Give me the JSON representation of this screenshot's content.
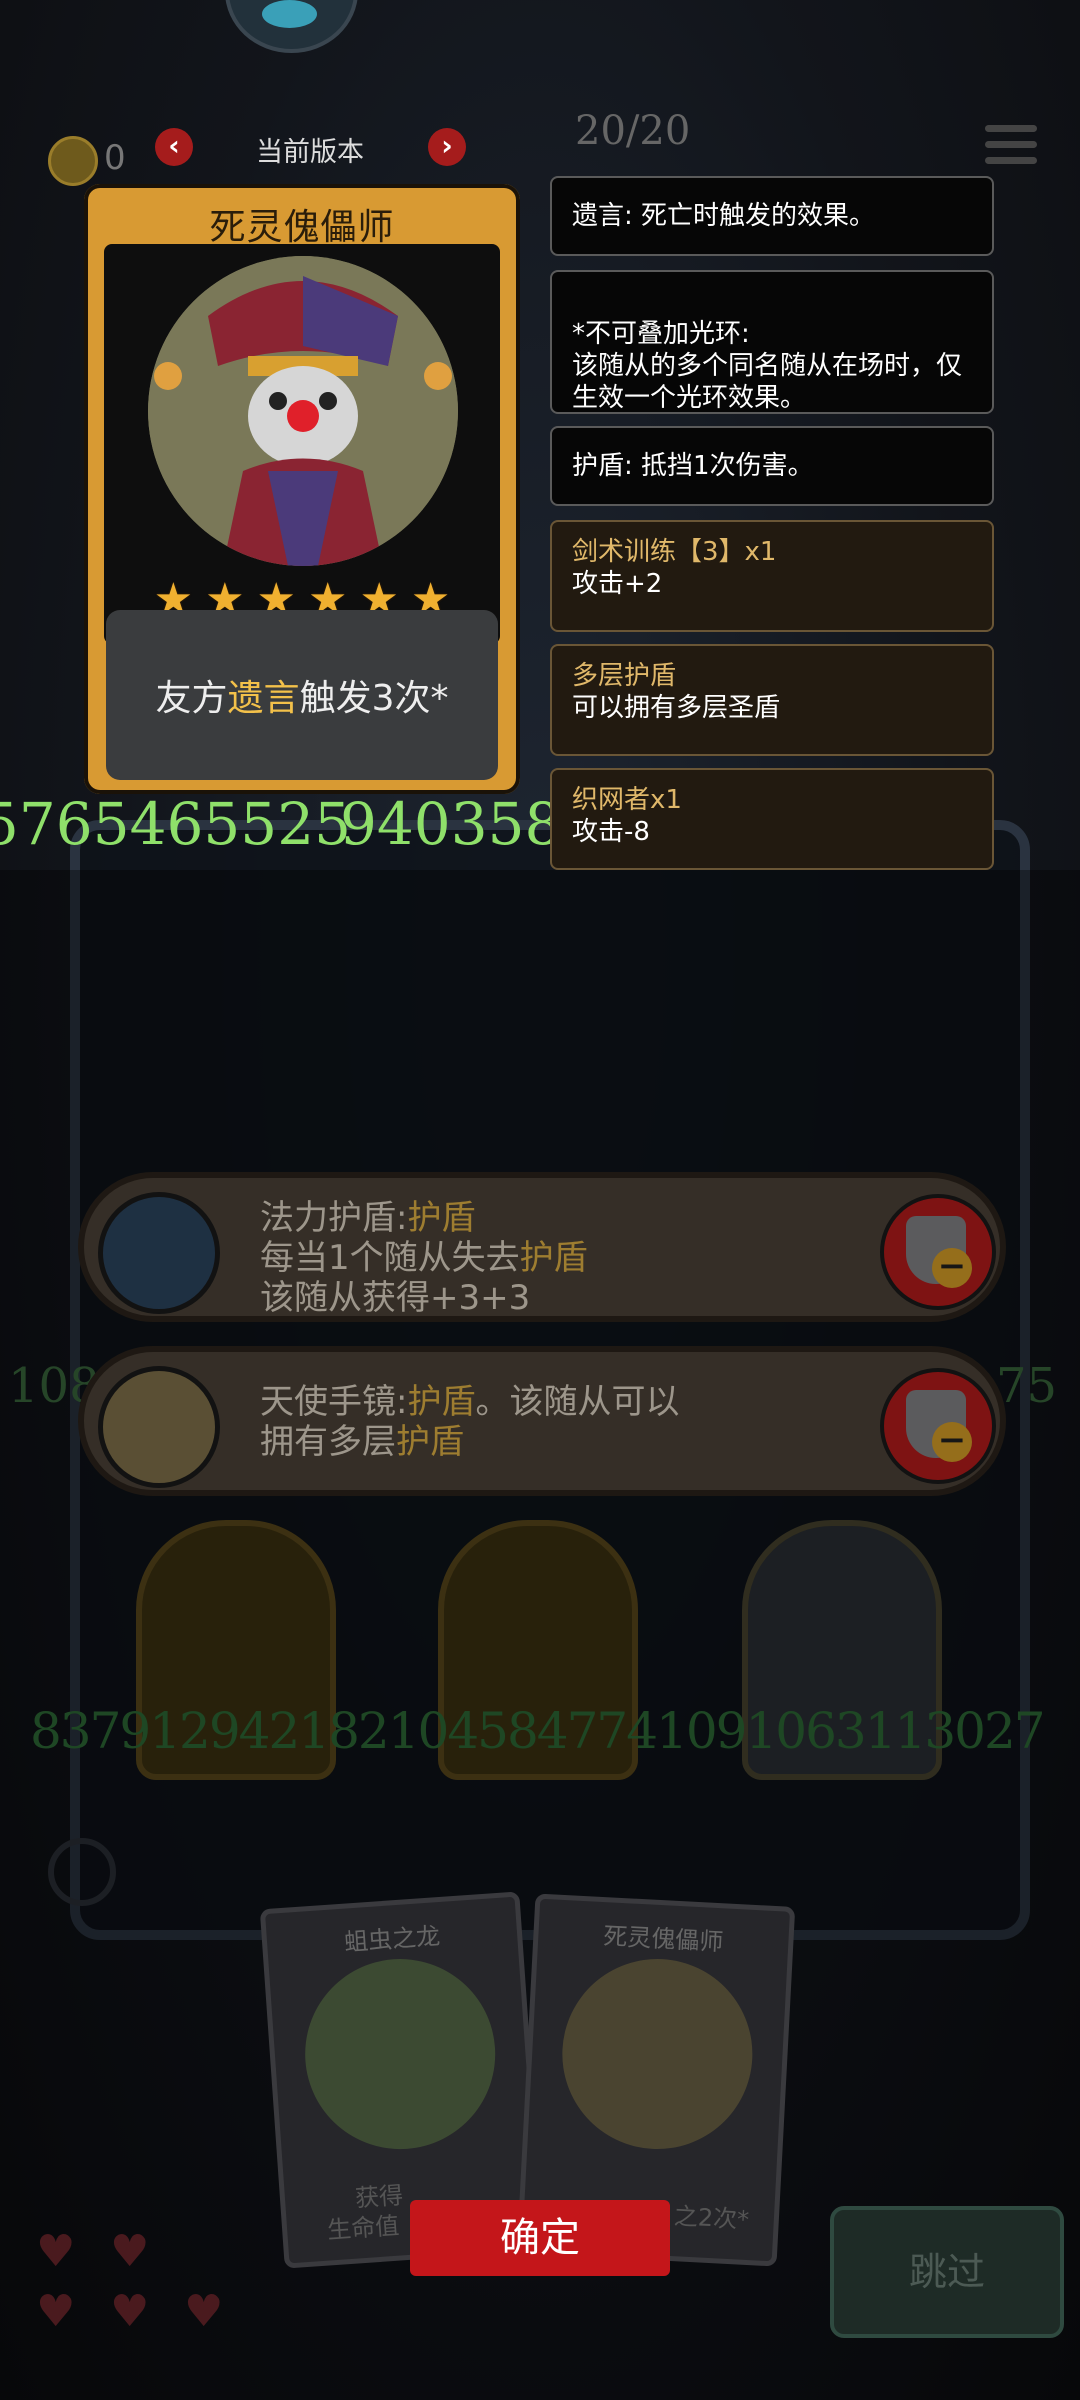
{
  "header": {
    "coin_count": "0",
    "version_label": "当前版本",
    "life": "20/20"
  },
  "card": {
    "name": "死灵傀儡师",
    "stars": 6,
    "desc_prefix": "友方",
    "desc_keyword": "遗言",
    "desc_suffix": "触发3次*",
    "attack": "5765465525",
    "health": "940358"
  },
  "keywords": [
    {
      "title": "",
      "text": "遗言: 死亡时触发的效果。"
    },
    {
      "title": "",
      "text": "*不可叠加光环:\n该随从的多个同名随从在场时，仅生效一个光环效果。"
    },
    {
      "title": "",
      "text": "护盾: 抵挡1次伤害。"
    },
    {
      "title": "剑术训练【3】x1",
      "text": "攻击+2"
    },
    {
      "title": "多层护盾",
      "text": "可以拥有多层圣盾"
    },
    {
      "title": "织网者x1",
      "text": "攻击-8"
    }
  ],
  "banners": [
    {
      "line1_a": "法力护盾:",
      "line1_b": "护盾",
      "line2_a": "每当1个随从失去",
      "line2_b": "护盾",
      "line3": "该随从获得+3+3"
    },
    {
      "line1_a": "天使手镜:",
      "line1_b": "护盾",
      "line1_c": "。该随从可以",
      "line2_a": "拥有多层",
      "line2_b": "护盾"
    }
  ],
  "side_numbers": {
    "left": "108",
    "right": "75"
  },
  "minion_numbers": "8379129421821045847741091063113027",
  "hand": [
    {
      "name": "蛆虫之龙",
      "line1": "获得",
      "line2": "生命值"
    },
    {
      "name": "死灵傀儡师",
      "line1": "之2次*"
    }
  ],
  "buttons": {
    "confirm": "确定",
    "skip": "跳过"
  },
  "colors": {
    "accent_gold": "#f3c14a",
    "stat_green": "#8fe06a",
    "confirm_red": "#c4161a"
  }
}
